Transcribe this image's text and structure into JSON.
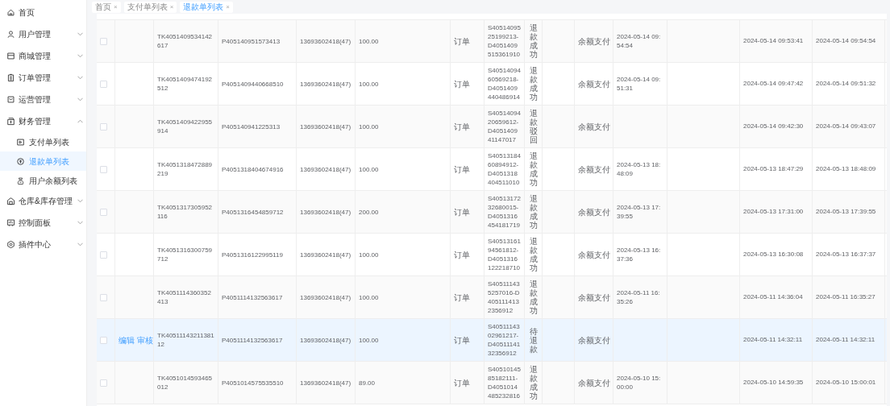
{
  "sidebar": {
    "items": [
      {
        "label": "首页"
      },
      {
        "label": "用户管理",
        "expanded": false
      },
      {
        "label": "商城管理",
        "expanded": false
      },
      {
        "label": "订单管理",
        "expanded": false
      },
      {
        "label": "运营管理",
        "expanded": false
      },
      {
        "label": "财务管理",
        "expanded": true,
        "children": [
          {
            "label": "支付单列表",
            "selected": false
          },
          {
            "label": "退款单列表",
            "selected": true
          },
          {
            "label": "用户余额列表",
            "selected": false
          }
        ]
      },
      {
        "label": "仓库&库存管理",
        "expanded": false
      },
      {
        "label": "控制面板",
        "expanded": false
      },
      {
        "label": "插件中心",
        "expanded": false
      }
    ]
  },
  "tabs": [
    {
      "label": "首页",
      "close": "×",
      "selected": false
    },
    {
      "label": "支付单列表",
      "close": "×",
      "selected": false
    },
    {
      "label": "退款单列表",
      "close": "×",
      "selected": true
    }
  ],
  "table": {
    "rows": [
      {
        "checked": false,
        "selected": false,
        "refund_no": "TK4051409534142617",
        "pay_no": "P405140951573413",
        "user": "13693602418(47)",
        "amount": "100.00",
        "type": "订单",
        "sub_order": "S4051409525199213-D4051409515361910",
        "status": "退款成功",
        "pay_method": "余额支付",
        "refund_time": "2024-05-14 09:54:54",
        "created": "2024-05-14 09:53:41",
        "updated": "2024-05-14 09:54:54"
      },
      {
        "checked": false,
        "selected": false,
        "refund_no": "TK4051409474192512",
        "pay_no": "P4051409440668510",
        "user": "13693602418(47)",
        "amount": "100.00",
        "type": "订单",
        "sub_order": "S4051409460569218-D4051409440486914",
        "status": "退款成功",
        "pay_method": "余额支付",
        "refund_time": "2024-05-14 09:51:31",
        "created": "2024-05-14 09:47:42",
        "updated": "2024-05-14 09:51:32"
      },
      {
        "checked": false,
        "selected": false,
        "refund_no": "TK4051409422955914",
        "pay_no": "P405140941225313",
        "user": "13693602418(47)",
        "amount": "100.00",
        "type": "订单",
        "sub_order": "S4051409420659612-D405140941147017",
        "status": "退款驳回",
        "pay_method": "余额支付",
        "created": "2024-05-14 09:42:30",
        "updated": "2024-05-14 09:43:07"
      },
      {
        "checked": false,
        "selected": false,
        "refund_no": "TK4051318472889219",
        "pay_no": "P4051318404674916",
        "user": "13693602418(47)",
        "amount": "100.00",
        "type": "订单",
        "sub_order": "S4051318460894912-D4051318404511010",
        "status": "退款成功",
        "pay_method": "余额支付",
        "refund_time": "2024-05-13 18:48:09",
        "created": "2024-05-13 18:47:29",
        "updated": "2024-05-13 18:48:09"
      },
      {
        "checked": false,
        "selected": false,
        "refund_no": "TK4051317305952116",
        "pay_no": "P4051316454859712",
        "user": "13693602418(47)",
        "amount": "200.00",
        "type": "订单",
        "sub_order": "S4051317232680015-D4051316454181719",
        "status": "退款成功",
        "pay_method": "余额支付",
        "refund_time": "2024-05-13 17:39:55",
        "created": "2024-05-13 17:31:00",
        "updated": "2024-05-13 17:39:55"
      },
      {
        "checked": false,
        "selected": false,
        "refund_no": "TK4051316300759712",
        "pay_no": "P4051316122995119",
        "user": "13693602418(47)",
        "amount": "100.00",
        "type": "订单",
        "sub_order": "S4051316194561812-D4051316122218710",
        "status": "退款成功",
        "pay_method": "余额支付",
        "refund_time": "2024-05-13 16:37:36",
        "created": "2024-05-13 16:30:08",
        "updated": "2024-05-13 16:37:37"
      },
      {
        "checked": false,
        "selected": false,
        "refund_no": "TK4051114360352413",
        "pay_no": "P4051114132563617",
        "user": "13693602418(47)",
        "amount": "100.00",
        "type": "订单",
        "sub_order": "S405111435257016-D4051114132356912",
        "status": "退款成功",
        "pay_method": "余额支付",
        "refund_time": "2024-05-11 16:35:26",
        "created": "2024-05-11 14:36:04",
        "updated": "2024-05-11 16:35:27"
      },
      {
        "checked": false,
        "selected": true,
        "actions": [
          "编辑",
          "审核"
        ],
        "refund_no": "TK4051114321138112",
        "pay_no": "P4051114132563617",
        "user": "13693602418(47)",
        "amount": "100.00",
        "type": "订单",
        "sub_order": "S4051114302961217-D4051114132356912",
        "status": "待退款",
        "pay_method": "余额支付",
        "created": "2024-05-11 14:32:11",
        "updated": "2024-05-11 14:32:11"
      },
      {
        "checked": false,
        "selected": false,
        "refund_no": "TK4051014593465012",
        "pay_no": "P4051014575535510",
        "user": "13693602418(47)",
        "amount": "89.00",
        "type": "订单",
        "sub_order": "S4051014585182111-D4051014485232816",
        "status": "退款成功",
        "pay_method": "余额支付",
        "refund_time": "2024-05-10 15:00:00",
        "created": "2024-05-10 14:59:35",
        "updated": "2024-05-10 15:00:01"
      }
    ]
  }
}
